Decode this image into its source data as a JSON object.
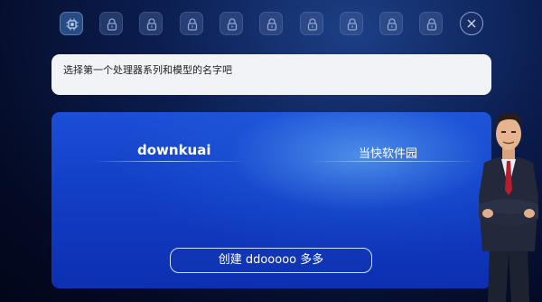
{
  "toolbar": {
    "slots": [
      {
        "icon": "chip-icon",
        "state": "unlocked"
      },
      {
        "icon": "lock-icon",
        "state": "locked"
      },
      {
        "icon": "lock-icon",
        "state": "locked"
      },
      {
        "icon": "lock-icon",
        "state": "locked"
      },
      {
        "icon": "lock-icon",
        "state": "locked"
      },
      {
        "icon": "lock-icon",
        "state": "locked"
      },
      {
        "icon": "lock-icon",
        "state": "locked"
      },
      {
        "icon": "lock-icon",
        "state": "locked"
      },
      {
        "icon": "lock-icon",
        "state": "locked"
      }
    ],
    "close_icon": "close-icon"
  },
  "dialog": {
    "text": "选择第一个处理器系列和模型的名字吧"
  },
  "panel": {
    "left_name": "downkuai",
    "right_name": "当快软件园",
    "create_button": "创建 ddooooo 多多"
  },
  "colors": {
    "background": "#040a24",
    "panel_blue": "#1642c8",
    "dialog_bg": "#f2f3f6"
  }
}
